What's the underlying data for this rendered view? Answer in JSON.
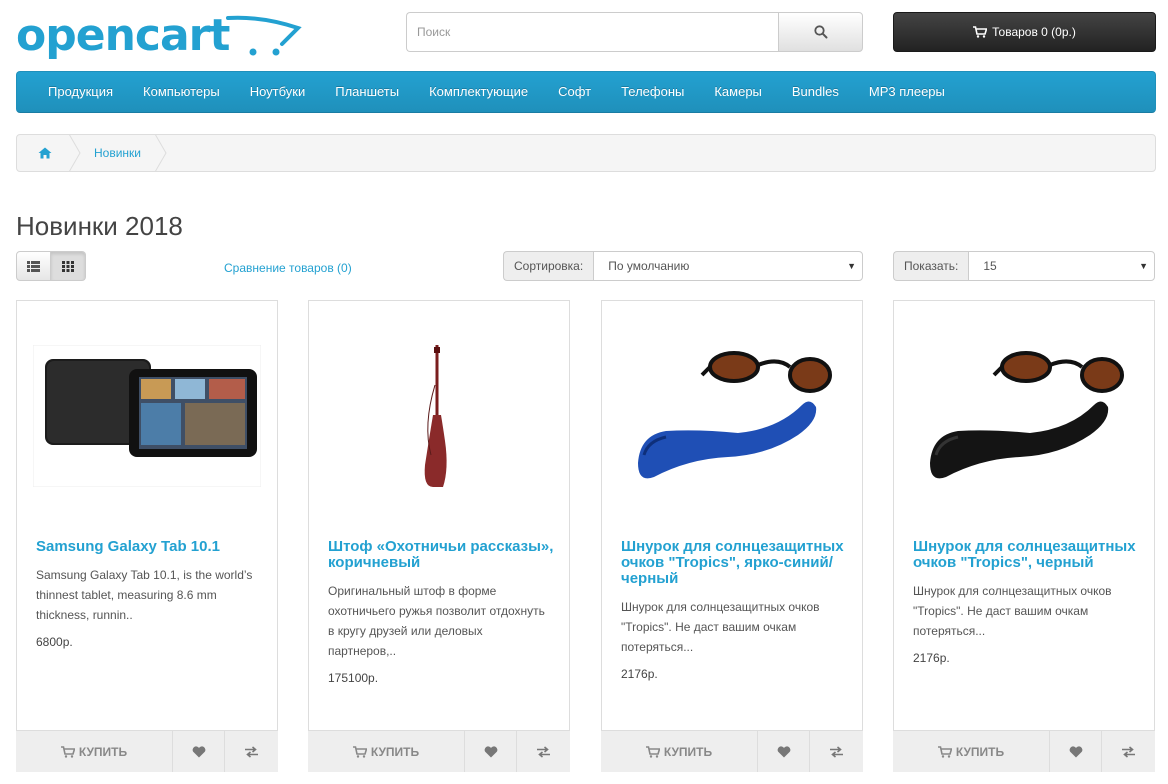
{
  "header": {
    "logo_text": "opencart",
    "brand_color": "#23a1d1",
    "search_placeholder": "Поиск",
    "search_icon": "search-icon",
    "cart_label": "Товаров 0 (0р.)",
    "cart_icon": "shopping-cart-icon"
  },
  "menu": {
    "items": [
      {
        "label": "Продукция"
      },
      {
        "label": "Компьютеры"
      },
      {
        "label": "Ноутбуки"
      },
      {
        "label": "Планшеты"
      },
      {
        "label": "Комплектующие"
      },
      {
        "label": "Софт"
      },
      {
        "label": "Телефоны"
      },
      {
        "label": "Камеры"
      },
      {
        "label": "Bundles"
      },
      {
        "label": "MP3 плееры"
      }
    ]
  },
  "breadcrumb": {
    "home_icon": "home-icon",
    "items": [
      {
        "label": "Новинки"
      }
    ]
  },
  "page": {
    "title": "Новинки 2018",
    "compare_label": "Сравнение товаров (0)",
    "sort_label": "Сортировка:",
    "sort_value": "По умолчанию",
    "limit_label": "Показать:",
    "limit_value": "15",
    "active_view": "grid"
  },
  "products": [
    {
      "name": "Samsung Galaxy Tab 10.1",
      "description": "Samsung Galaxy Tab 10.1, is the world’s thinnest tablet, measuring 8.6 mm thickness, runnin..",
      "price": "6800р.",
      "buy_label": "Купить"
    },
    {
      "name": "Штоф «Охотничьи рассказы», коричневый",
      "description": "Оригинальный штоф в форме охотничьего ружья позволит отдохнуть в кругу друзей или деловых партнеров,..",
      "price": "175100р.",
      "buy_label": "Купить"
    },
    {
      "name": "Шнурок для солнцезащитных очков \"Tropics\", ярко-синий/черный",
      "description": "Шнурок для солнцезащитных очков \"Tropics\". Не даст вашим очкам потеряться...",
      "price": "2176р.",
      "buy_label": "Купить"
    },
    {
      "name": "Шнурок для солнцезащитных очков \"Tropics\", черный",
      "description": "Шнурок для солнцезащитных очков \"Tropics\". Не даст вашим очкам потеряться...",
      "price": "2176р.",
      "buy_label": "Купить"
    }
  ]
}
